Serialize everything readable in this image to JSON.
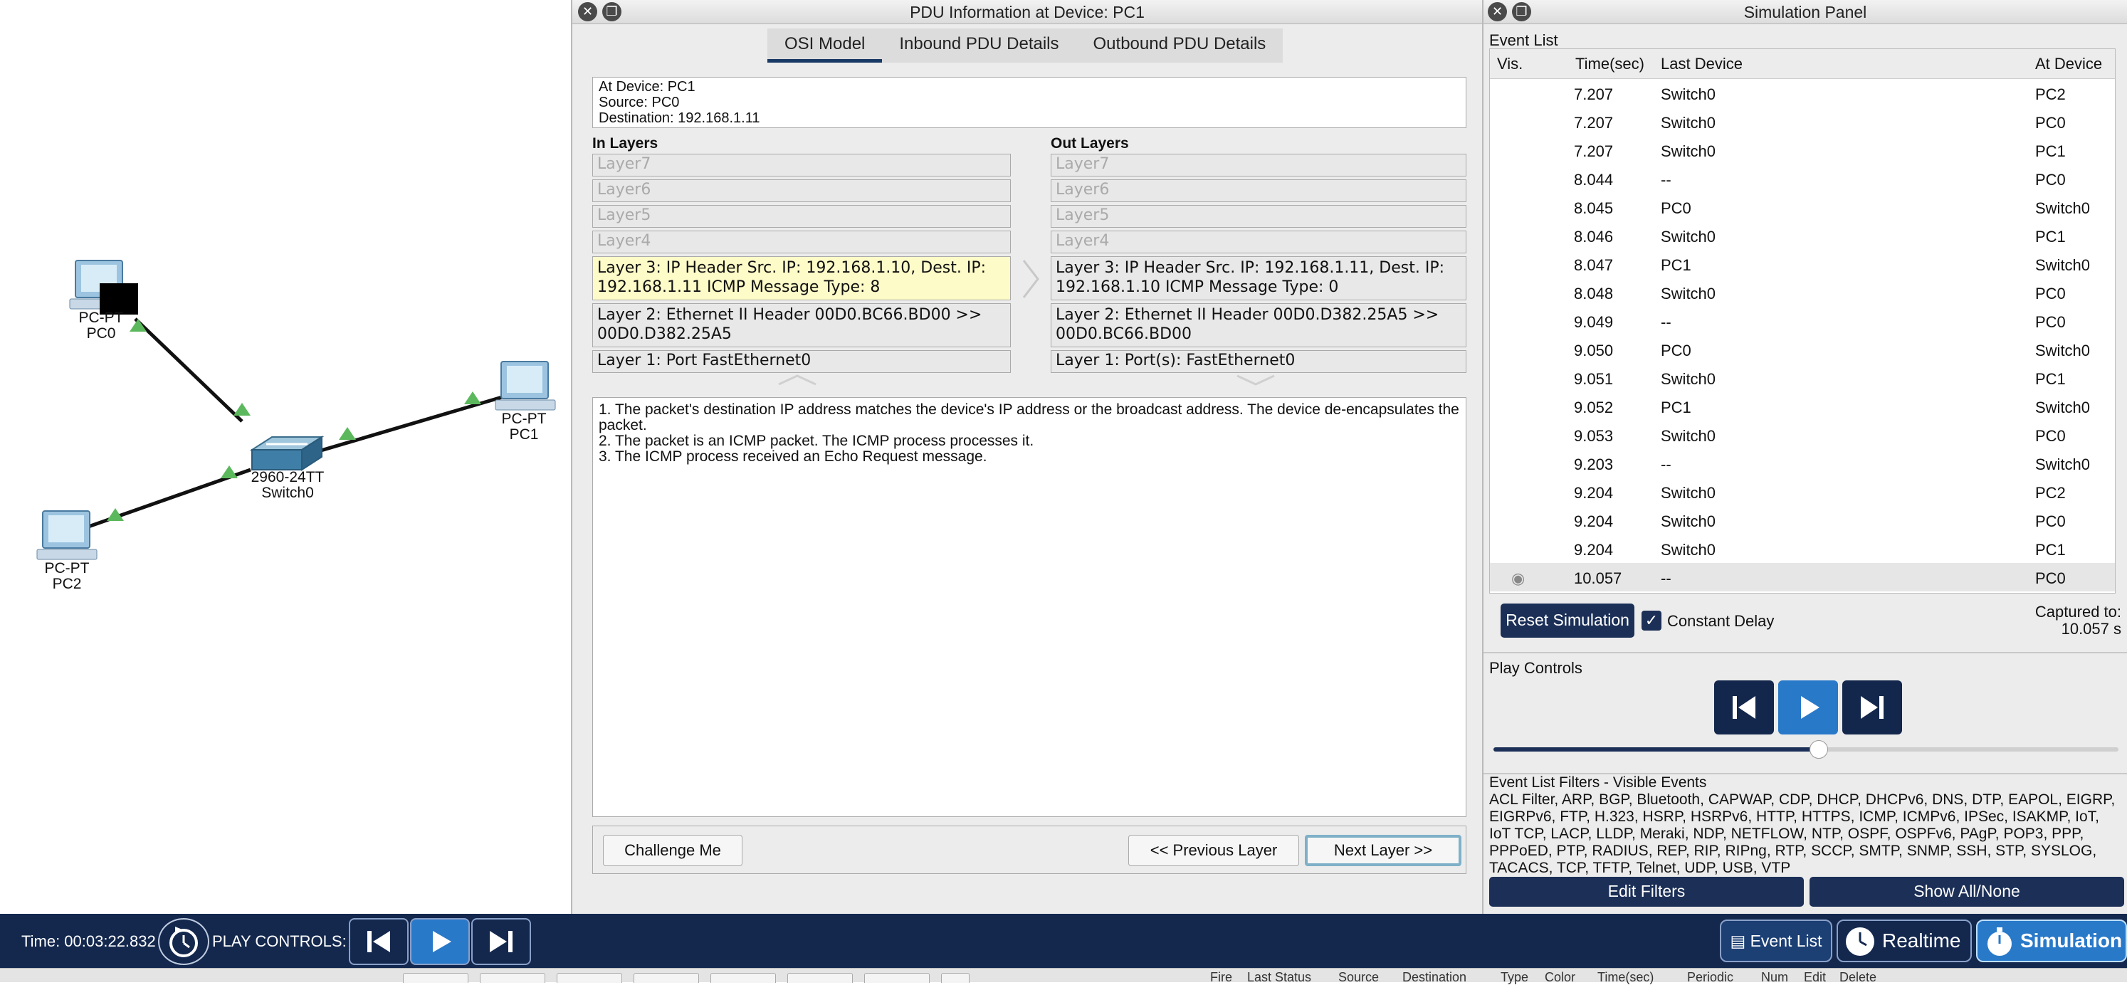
{
  "topology": {
    "devices": [
      {
        "type": "PC-PT",
        "name": "PC0"
      },
      {
        "type": "PC-PT",
        "name": "PC1"
      },
      {
        "type": "PC-PT",
        "name": "PC2"
      },
      {
        "type": "2960-24TT",
        "name": "Switch0"
      }
    ],
    "link_color": "#111111",
    "link_status_color": "#5cb85c"
  },
  "pdu_window": {
    "title": "PDU Information at Device: PC1",
    "tabs": [
      "OSI Model",
      "Inbound PDU Details",
      "Outbound PDU Details"
    ],
    "active_tab": "OSI Model",
    "info": {
      "device": "At Device: PC1",
      "source": "Source: PC0",
      "destination": "Destination: 192.168.1.11"
    },
    "in_layers_label": "In Layers",
    "out_layers_label": "Out Layers",
    "in_layers": [
      "Layer7",
      "Layer6",
      "Layer5",
      "Layer4",
      "Layer 3: IP Header Src. IP: 192.168.1.10, Dest. IP: 192.168.1.11 ICMP Message Type: 8",
      "Layer 2: Ethernet II Header 00D0.BC66.BD00 >> 00D0.D382.25A5",
      "Layer 1: Port FastEthernet0"
    ],
    "out_layers": [
      "Layer7",
      "Layer6",
      "Layer5",
      "Layer4",
      "Layer 3: IP Header Src. IP: 192.168.1.11, Dest. IP: 192.168.1.10 ICMP Message Type: 0",
      "Layer 2: Ethernet II Header 00D0.D382.25A5 >> 00D0.BC66.BD00",
      "Layer 1: Port(s): FastEthernet0"
    ],
    "highlight_color": "#fdfbc8",
    "description": [
      "1. The packet's destination IP address matches the device's IP address or the broadcast address. The device de-encapsulates the packet.",
      "2. The packet is an ICMP packet. The ICMP process processes it.",
      "3. The ICMP process received an Echo Request message."
    ],
    "buttons": {
      "challenge": "Challenge Me",
      "previous": "<< Previous Layer",
      "next": "Next Layer >>"
    }
  },
  "sim_panel": {
    "title": "Simulation Panel",
    "event_list_label": "Event List",
    "columns": [
      "Vis.",
      "Time(sec)",
      "Last Device",
      "At Device"
    ],
    "events": [
      {
        "time": "7.207",
        "last": "Switch0",
        "at": "PC2"
      },
      {
        "time": "7.207",
        "last": "Switch0",
        "at": "PC0"
      },
      {
        "time": "7.207",
        "last": "Switch0",
        "at": "PC1"
      },
      {
        "time": "8.044",
        "last": "--",
        "at": "PC0"
      },
      {
        "time": "8.045",
        "last": "PC0",
        "at": "Switch0"
      },
      {
        "time": "8.046",
        "last": "Switch0",
        "at": "PC1"
      },
      {
        "time": "8.047",
        "last": "PC1",
        "at": "Switch0"
      },
      {
        "time": "8.048",
        "last": "Switch0",
        "at": "PC0"
      },
      {
        "time": "9.049",
        "last": "--",
        "at": "PC0"
      },
      {
        "time": "9.050",
        "last": "PC0",
        "at": "Switch0"
      },
      {
        "time": "9.051",
        "last": "Switch0",
        "at": "PC1"
      },
      {
        "time": "9.052",
        "last": "PC1",
        "at": "Switch0"
      },
      {
        "time": "9.053",
        "last": "Switch0",
        "at": "PC0"
      },
      {
        "time": "9.203",
        "last": "--",
        "at": "Switch0"
      },
      {
        "time": "9.204",
        "last": "Switch0",
        "at": "PC2"
      },
      {
        "time": "9.204",
        "last": "Switch0",
        "at": "PC0"
      },
      {
        "time": "9.204",
        "last": "Switch0",
        "at": "PC1"
      },
      {
        "time": "10.057",
        "last": "--",
        "at": "PC0"
      }
    ],
    "reset_button": "Reset Simulation",
    "constant_delay_label": "Constant Delay",
    "constant_delay_checked": true,
    "captured_label": "Captured to:",
    "captured_value": "10.057 s",
    "play_controls_label": "Play Controls",
    "play_speed": 0.52,
    "filters_label": "Event List Filters - Visible Events",
    "filters_text": "ACL Filter, ARP, BGP, Bluetooth, CAPWAP, CDP, DHCP, DHCPv6, DNS, DTP, EAPOL, EIGRP, EIGRPv6, FTP, H.323, HSRP, HSRPv6, HTTP, HTTPS, ICMP, ICMPv6, IPSec, ISAKMP, IoT, IoT TCP, LACP, LLDP, Meraki, NDP, NETFLOW, NTP, OSPF, OSPFv6, PAgP, POP3, PPP, PPPoED, PTP, RADIUS, REP, RIP, RIPng, RTP, SCCP, SMTP, SNMP, SSH, STP, SYSLOG, TACACS, TCP, TFTP, Telnet, UDP, USB, VTP",
    "edit_filters": "Edit Filters",
    "show_all": "Show All/None"
  },
  "bottom_bar": {
    "time": "Time: 00:03:22.832",
    "play_controls": "PLAY CONTROLS:",
    "event_list": "Event List",
    "realtime": "Realtime",
    "simulation": "Simulation"
  },
  "pdu_list_strip": {
    "columns": [
      "Fire",
      "Last Status",
      "Source",
      "Destination",
      "Type",
      "Color",
      "Time(sec)",
      "Periodic",
      "Num",
      "Edit",
      "Delete"
    ]
  },
  "colors": {
    "navy": "#14284e",
    "accent_blue": "#2979c9"
  }
}
